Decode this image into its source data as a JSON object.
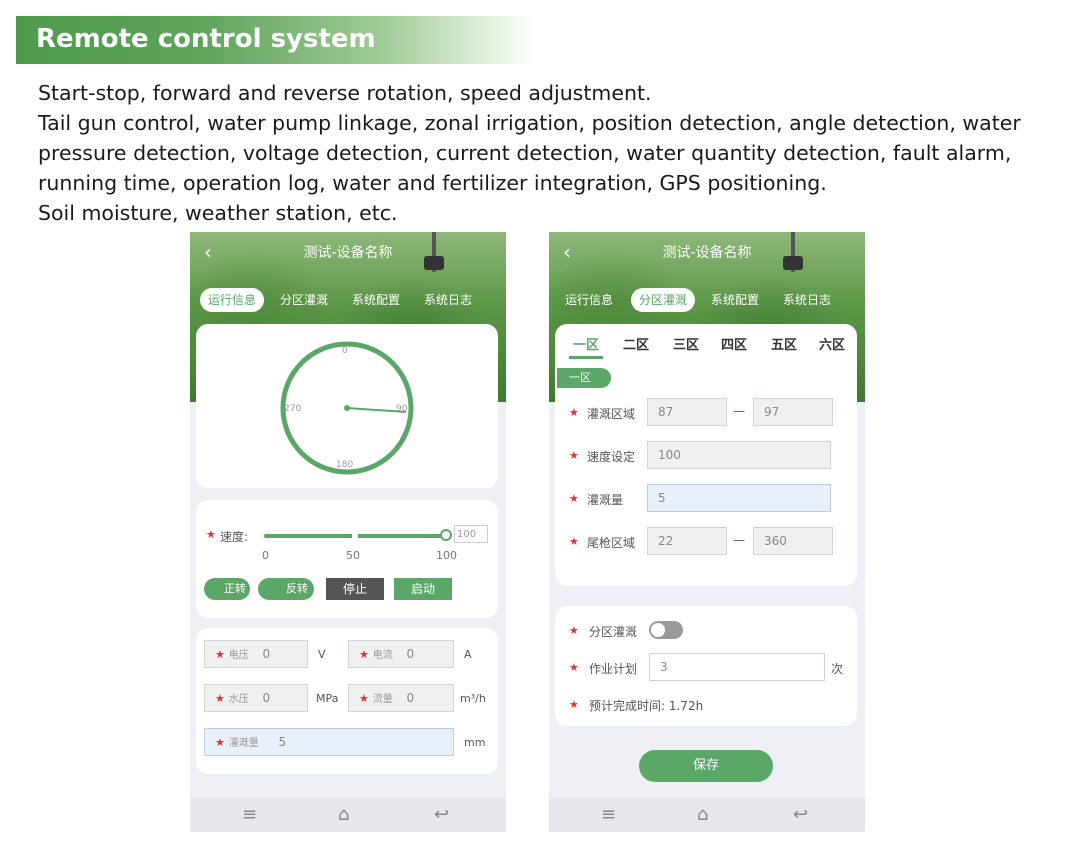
{
  "header": {
    "title": "Remote control system"
  },
  "description": [
    "Start-stop, forward and reverse rotation, speed adjustment.",
    "Tail gun control, water pump linkage, zonal irrigation, position detection, angle detection, water pressure detection, voltage detection, current detection, water quantity detection, fault alarm, running time, operation log, water and fertilizer integration, GPS positioning.",
    "Soil moisture, weather station, etc."
  ],
  "colors": {
    "accent": "#5aa768",
    "dark_button": "#555555",
    "required_star": "#d33333"
  },
  "phone1": {
    "back_icon": "‹",
    "title": "测试-设备名称",
    "tabs": [
      "运行信息",
      "分区灌溉",
      "系统配置",
      "系统日志"
    ],
    "gauge": {
      "top": "0",
      "right": "90",
      "bottom": "180",
      "left": "270"
    },
    "speed": {
      "label": "速度:",
      "value": "100",
      "ticks": [
        "0",
        "50",
        "100"
      ],
      "level_percent": 100
    },
    "buttons": {
      "forward": "正转",
      "reverse": "反转",
      "stop": "停止",
      "start": "启动"
    },
    "readings": {
      "voltage": {
        "label": "电压",
        "value": "0",
        "unit": "V"
      },
      "current": {
        "label": "电流",
        "value": "0",
        "unit": "A"
      },
      "pressure": {
        "label": "水压",
        "value": "0",
        "unit": "MPa"
      },
      "flow": {
        "label": "流量",
        "value": "0",
        "unit": "m³/h"
      },
      "irrigation": {
        "label": "灌溉量",
        "value": "5",
        "unit": "mm"
      }
    }
  },
  "phone2": {
    "back_icon": "‹",
    "title": "测试-设备名称",
    "tabs": [
      "运行信息",
      "分区灌溉",
      "系统配置",
      "系统日志"
    ],
    "zones": [
      "一区",
      "二区",
      "三区",
      "四区",
      "五区",
      "六区"
    ],
    "zone_badge": "一区",
    "rows": {
      "area": {
        "label": "灌溉区域",
        "from": "87",
        "to": "97"
      },
      "speed": {
        "label": "速度设定",
        "value": "100"
      },
      "amount": {
        "label": "灌溉量",
        "value": "5"
      },
      "tail_gun": {
        "label": "尾枪区域",
        "from": "22",
        "to": "360"
      }
    },
    "dash": "—",
    "zonal_irrigation": {
      "label": "分区灌溉"
    },
    "plan": {
      "label": "作业计划",
      "value": "3",
      "unit": "次"
    },
    "eta": {
      "label": "预计完成时间: 1.72h"
    },
    "save": "保存"
  },
  "nav_icons": [
    "menu-icon",
    "home-icon",
    "back-icon"
  ]
}
